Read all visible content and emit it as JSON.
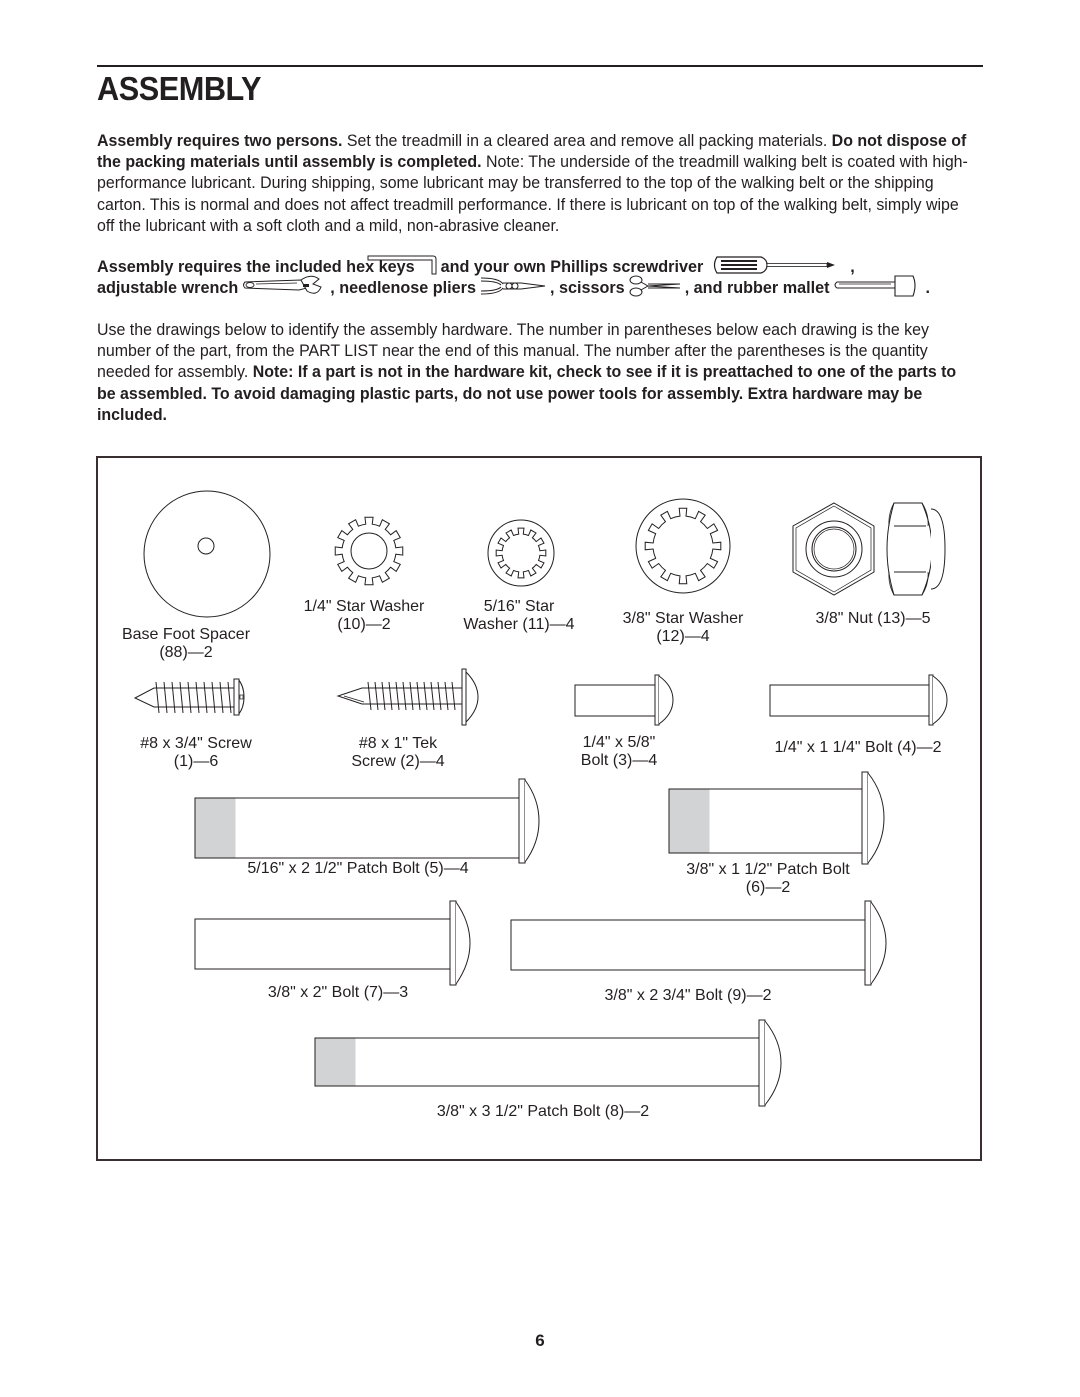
{
  "page": {
    "title": "ASSEMBLY",
    "page_number": "6"
  },
  "intro": {
    "bold_1": "Assembly requires two persons.",
    "text_1": " Set the treadmill in a cleared area and remove all packing materials. ",
    "bold_2": "Do not dispose of the packing materials until assembly is completed.",
    "text_2": " Note: The underside of the treadmill walking belt is coated with high-performance lubricant. During shipping, some lubricant may be transferred to the top of the walking belt or the shipping carton. This is normal and does not affect treadmill performance. If there is lubricant on top of the walking belt, simply wipe off the lubricant with a soft cloth and a mild, non-abrasive cleaner."
  },
  "tools": {
    "lead": "Assembly requires the included hex keys",
    "after_hex": "and your own Phillips screwdriver",
    "comma": ",",
    "wrench": "adjustable wrench",
    "pliers": ", needlenose pliers",
    "scissors": ", scissors",
    "mallet": ", and rubber mallet",
    "period": ".",
    "icons": [
      "hex-key-icon",
      "phillips-screwdriver-icon",
      "adjustable-wrench-icon",
      "needlenose-pliers-icon",
      "scissors-icon",
      "rubber-mallet-icon"
    ]
  },
  "instructions": {
    "text_1": "Use the drawings below to identify the assembly hardware. The number in parentheses below each drawing is the key number of the part, from the PART LIST near the end of this manual. The number after the parentheses is the quantity needed for assembly. ",
    "bold_1": "Note: If a part is not in the hardware kit, check to see if it is preattached to one of the parts to be assembled. To avoid damaging plastic parts, do not use power tools for assembly. Extra hardware may be included."
  },
  "hardware": [
    {
      "name": "Base Foot Spacer",
      "line1": "Base Foot Spacer",
      "line2": "(88)—2",
      "key": 88,
      "qty": 2
    },
    {
      "name": "1/4\" Star Washer",
      "line1": "1/4\" Star Washer",
      "line2": "(10)—2",
      "key": 10,
      "qty": 2
    },
    {
      "name": "5/16\" Star Washer",
      "line1": "5/16\" Star",
      "line2": "Washer (11)—4",
      "key": 11,
      "qty": 4
    },
    {
      "name": "3/8\" Star Washer",
      "line1": "3/8\" Star Washer",
      "line2": "(12)—4",
      "key": 12,
      "qty": 4
    },
    {
      "name": "3/8\" Nut",
      "line1": "3/8\" Nut (13)—5",
      "line2": "",
      "key": 13,
      "qty": 5
    },
    {
      "name": "#8 x 3/4\" Screw",
      "line1": "#8 x 3/4\" Screw",
      "line2": "(1)—6",
      "key": 1,
      "qty": 6
    },
    {
      "name": "#8 x 1\" Tek Screw",
      "line1": "#8 x 1\" Tek",
      "line2": "Screw (2)—4",
      "key": 2,
      "qty": 4
    },
    {
      "name": "1/4\" x 5/8\" Bolt",
      "line1": "1/4\" x 5/8\"",
      "line2": "Bolt (3)—4",
      "key": 3,
      "qty": 4
    },
    {
      "name": "1/4\" x 1 1/4\" Bolt",
      "line1": "1/4\" x 1 1/4\" Bolt (4)—2",
      "line2": "",
      "key": 4,
      "qty": 2
    },
    {
      "name": "5/16\" x 2 1/2\" Patch Bolt",
      "line1": "5/16\" x 2 1/2\" Patch Bolt (5)—4",
      "line2": "",
      "key": 5,
      "qty": 4
    },
    {
      "name": "3/8\" x 1 1/2\" Patch Bolt",
      "line1": "3/8\" x 1 1/2\" Patch Bolt",
      "line2": "(6)—2",
      "key": 6,
      "qty": 2
    },
    {
      "name": "3/8\" x 2\" Bolt",
      "line1": "3/8\" x 2\" Bolt (7)—3",
      "line2": "",
      "key": 7,
      "qty": 3
    },
    {
      "name": "3/8\" x 2 3/4\" Bolt",
      "line1": "3/8\" x 2 3/4\" Bolt (9)—2",
      "line2": "",
      "key": 9,
      "qty": 2
    },
    {
      "name": "3/8\" x 3 1/2\" Patch Bolt",
      "line1": "3/8\" x 3 1/2\" Patch Bolt (8)—2",
      "line2": "",
      "key": 8,
      "qty": 2
    }
  ],
  "colors": {
    "ink": "#231f20",
    "patch": "#d1d3d4",
    "frame": "#3a2f30"
  }
}
